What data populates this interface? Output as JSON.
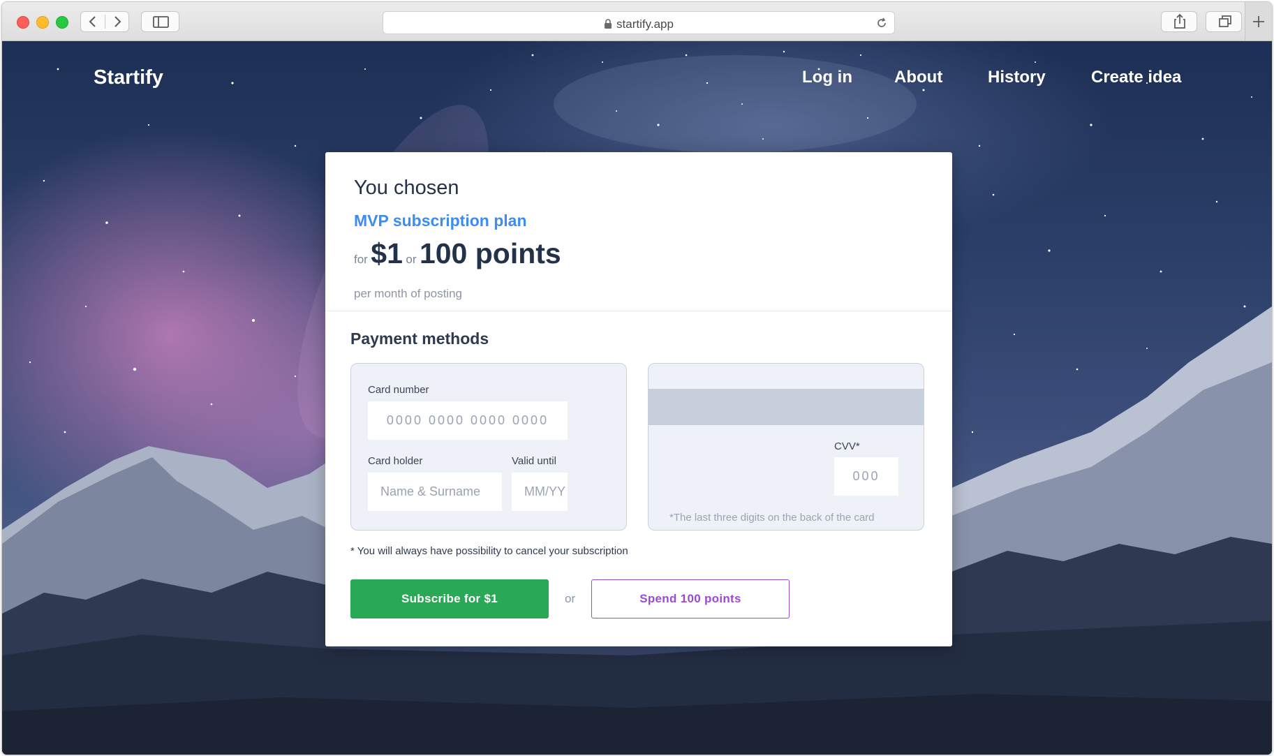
{
  "browser": {
    "url": "startify.app"
  },
  "nav": {
    "brand": "Startify",
    "links": [
      "Log in",
      "About",
      "History",
      "Create idea"
    ]
  },
  "plan": {
    "heading": "You chosen",
    "name": "MVP subscription plan",
    "for_word": "for",
    "price": "$1",
    "or_word": "or",
    "points": "100 points",
    "period": "per month of posting"
  },
  "payment": {
    "title": "Payment methods",
    "card_number_label": "Card number",
    "card_number_placeholder": "0000 0000 0000 0000",
    "card_holder_label": "Card holder",
    "card_holder_placeholder": "Name & Surname",
    "valid_until_label": "Valid until",
    "valid_until_placeholder": "MM/YY",
    "cvv_label": "CVV*",
    "cvv_placeholder": "000",
    "cvv_hint": "*The last three digits on the back of the card",
    "cancel_note": "* You will always have possibility to cancel your subscription",
    "subscribe_button": "Subscribe for $1",
    "or_text": "or",
    "points_button": "Spend 100 points"
  },
  "colors": {
    "accent_blue": "#3d8cf0",
    "subscribe_green": "#29a955",
    "points_purple": "#9b4ad6",
    "dark_text": "#243249"
  }
}
